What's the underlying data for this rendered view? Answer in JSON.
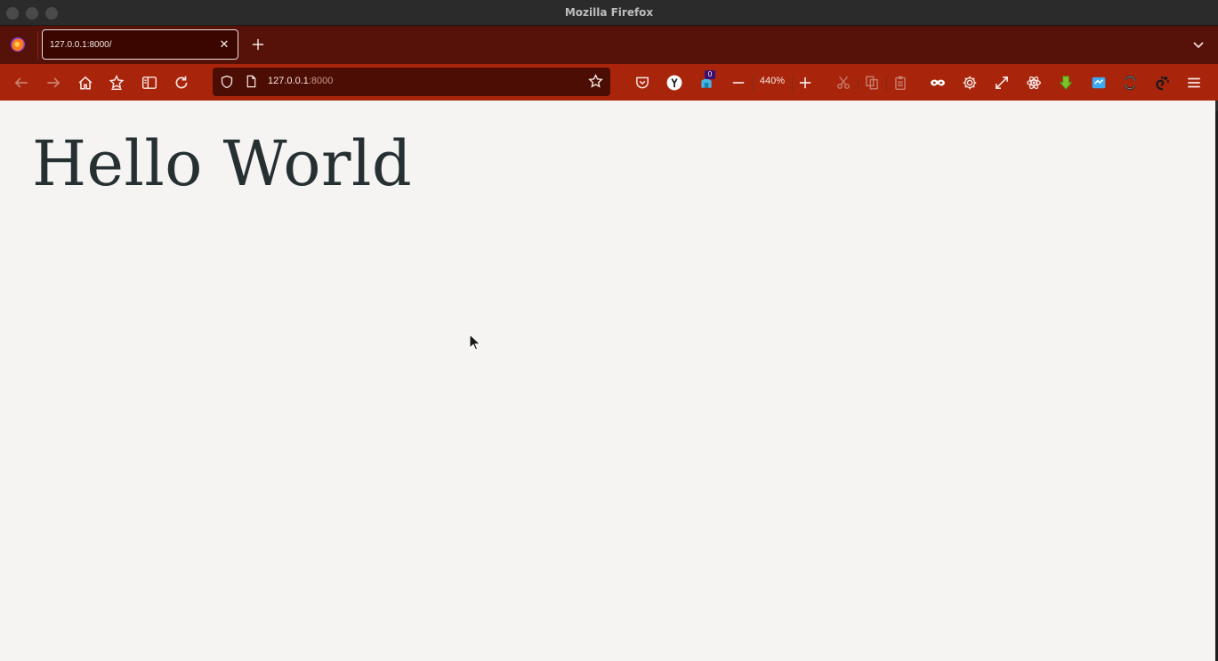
{
  "window": {
    "title": "Mozilla Firefox"
  },
  "tabs": [
    {
      "title": "127.0.0.1:8000/",
      "active": true
    }
  ],
  "urlbar": {
    "host": "127.0.0.1",
    "port": ":8000"
  },
  "toolbar": {
    "zoom_level": "440%",
    "container_badge": "0"
  },
  "page": {
    "heading": "Hello World"
  },
  "colors": {
    "tabstrip": "#561109",
    "navbar": "#a8250c",
    "urlbar": "#4c0d04",
    "page_background": "#f5f4f2",
    "heading": "#263032"
  },
  "icons": [
    "firefox-logo-icon",
    "close-icon",
    "plus-icon",
    "chevron-down-icon",
    "back-arrow-icon",
    "forward-arrow-icon",
    "home-icon",
    "extension-icon",
    "sidebar-icon",
    "reload-icon",
    "shield-icon",
    "page-icon",
    "star-icon",
    "pocket-icon",
    "yandex-icon",
    "container-icon",
    "minus-icon",
    "cut-icon",
    "copy-icon",
    "paste-icon",
    "private-mask-icon",
    "gear-icon",
    "fullscreen-icon",
    "react-devtools-icon",
    "download-icon",
    "screenshot-icon",
    "sync-icon",
    "gnome-icon",
    "hamburger-menu-icon",
    "mouse-cursor-icon"
  ]
}
